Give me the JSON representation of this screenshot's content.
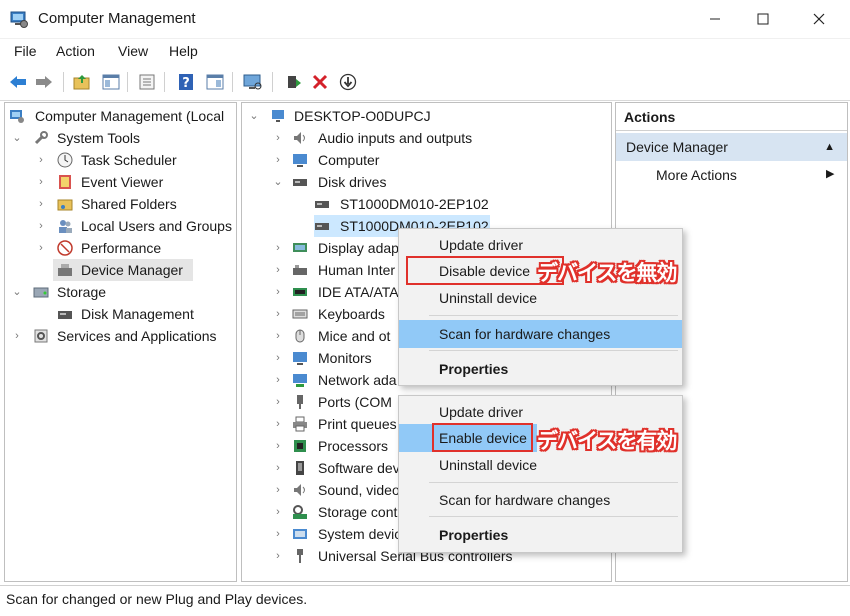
{
  "window": {
    "title": "Computer Management",
    "min_icon": "minimize-icon",
    "max_icon": "maximize-icon",
    "close_icon": "close-icon"
  },
  "menu": [
    "File",
    "Action",
    "View",
    "Help"
  ],
  "left_tree": [
    {
      "label": "Computer Management (Local",
      "icon": "computer-management-icon"
    },
    {
      "label": "System Tools",
      "icon": "tools-icon"
    },
    {
      "label": "Task Scheduler",
      "icon": "clock-icon"
    },
    {
      "label": "Event Viewer",
      "icon": "event-viewer-icon"
    },
    {
      "label": "Shared Folders",
      "icon": "shared-folder-icon"
    },
    {
      "label": "Local Users and Groups",
      "icon": "users-icon"
    },
    {
      "label": "Performance",
      "icon": "performance-icon"
    },
    {
      "label": "Device Manager",
      "icon": "device-manager-icon"
    },
    {
      "label": "Storage",
      "icon": "storage-icon"
    },
    {
      "label": "Disk Management",
      "icon": "disk-icon"
    },
    {
      "label": "Services and Applications",
      "icon": "services-icon"
    }
  ],
  "device_tree": [
    {
      "label": "DESKTOP-O0DUPCJ"
    },
    {
      "label": "Audio inputs and outputs"
    },
    {
      "label": "Computer"
    },
    {
      "label": "Disk drives"
    },
    {
      "label": "ST1000DM010-2EP102"
    },
    {
      "label": "ST1000DM010-2EP102"
    },
    {
      "label": "Display adap"
    },
    {
      "label": "Human Inter"
    },
    {
      "label": "IDE ATA/ATA"
    },
    {
      "label": "Keyboards"
    },
    {
      "label": "Mice and ot"
    },
    {
      "label": "Monitors"
    },
    {
      "label": "Network ada"
    },
    {
      "label": "Ports (COM"
    },
    {
      "label": "Print queues"
    },
    {
      "label": "Processors"
    },
    {
      "label": "Software dev"
    },
    {
      "label": "Sound, video"
    },
    {
      "label": "Storage cont"
    },
    {
      "label": "System devic"
    },
    {
      "label": "Universal Serial Bus controllers"
    }
  ],
  "actions": {
    "header": "Actions",
    "section": "Device Manager",
    "more": "More Actions"
  },
  "context_menu_1": {
    "items": [
      "Update driver",
      "Disable device",
      "Uninstall device",
      "Scan for hardware changes",
      "Properties"
    ],
    "annotation": "デバイスを無効"
  },
  "context_menu_2": {
    "items": [
      "Update driver",
      "Enable device",
      "Uninstall device",
      "Scan for hardware changes",
      "Properties"
    ],
    "annotation": "デバイスを有効"
  },
  "status": "Scan for changed or new Plug and Play devices.",
  "colors": {
    "highlight": "#91c9f7",
    "annotation_red": "#e0312b",
    "actions_band": "#d7e4f2"
  }
}
